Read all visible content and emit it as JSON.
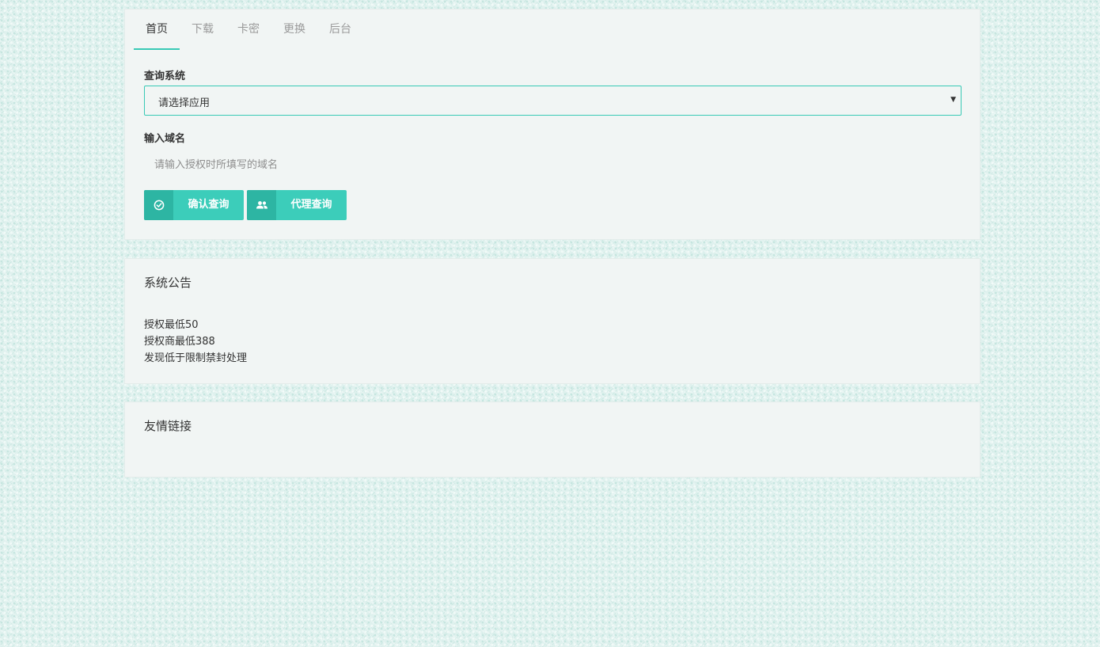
{
  "tabs": [
    {
      "label": "首页",
      "active": true
    },
    {
      "label": "下载",
      "active": false
    },
    {
      "label": "卡密",
      "active": false
    },
    {
      "label": "更换",
      "active": false
    },
    {
      "label": "后台",
      "active": false
    }
  ],
  "query": {
    "system_label": "查询系统",
    "select_value": "请选择应用",
    "domain_label": "输入域名",
    "domain_placeholder": "请输入授权时所填写的域名",
    "domain_value": ""
  },
  "buttons": {
    "confirm_label": "确认查询",
    "agent_label": "代理查询"
  },
  "icons": {
    "confirm": "check-circle-icon",
    "agent": "users-icon",
    "caret": "caret-down-icon"
  },
  "notice": {
    "title": "系统公告",
    "lines": [
      "授权最低50",
      "授权商最低388",
      "发现低于限制禁封处理"
    ]
  },
  "links": {
    "title": "友情链接"
  },
  "colors": {
    "accent": "#38c9b5",
    "button": "#3ccdba",
    "button_icon_bg": "#2db5a3",
    "card_bg": "#f1f5f4",
    "page_bg": "#dff1ee"
  }
}
